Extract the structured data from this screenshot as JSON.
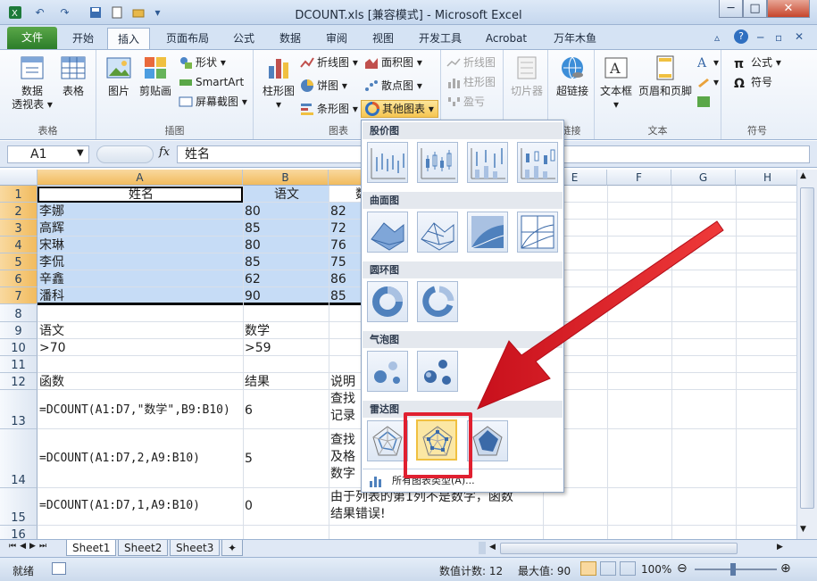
{
  "window": {
    "title": "DCOUNT.xls  [兼容模式] - Microsoft Excel",
    "minimize": "─",
    "restore": "□",
    "close": "✕"
  },
  "ribbon_tabs": [
    "文件",
    "开始",
    "插入",
    "页面布局",
    "公式",
    "数据",
    "审阅",
    "视图",
    "开发工具",
    "Acrobat",
    "万年木鱼"
  ],
  "ribbon": {
    "groups": {
      "tables": "表格",
      "illustrations": "插图",
      "charts": "图表",
      "links": "链接",
      "text": "文本",
      "symbols": "符号"
    },
    "pivot": "数据\n透视表",
    "pivot_line1": "数据",
    "pivot_line2": "透视表",
    "table": "表格",
    "picture": "图片",
    "clipart": "剪贴画",
    "shapes": "形状",
    "smartart": "SmartArt",
    "screenshot": "屏幕截图",
    "column_chart": "柱形图",
    "line_chart": "折线图",
    "pie_chart": "饼图",
    "bar_chart": "条形图",
    "area_chart": "面积图",
    "scatter_chart": "散点图",
    "other_charts": "其他图表",
    "spark_line": "折线图",
    "spark_column": "柱形图",
    "spark_winloss": "盈亏",
    "slicer": "切片器",
    "hyperlink": "超链接",
    "textbox": "文本框",
    "header_footer": "页眉和页脚",
    "formula": "公式",
    "symbol": "符号"
  },
  "formula_bar": {
    "name_box": "A1",
    "fx": "fx",
    "content": "姓名"
  },
  "columns": [
    "A",
    "B",
    "C",
    "D",
    "E",
    "F",
    "G",
    "H"
  ],
  "rows": [
    "1",
    "2",
    "3",
    "4",
    "5",
    "6",
    "7",
    "8",
    "9",
    "10",
    "11",
    "12",
    "13",
    "14",
    "15",
    "16"
  ],
  "cells": {
    "r1": [
      "姓名",
      "语文",
      "数"
    ],
    "r2": [
      "李娜",
      "80",
      "82"
    ],
    "r3": [
      "高辉",
      "85",
      "72"
    ],
    "r4": [
      "宋琳",
      "80",
      "76"
    ],
    "r5": [
      "李侃",
      "85",
      "75"
    ],
    "r6": [
      "辛鑫",
      "62",
      "86"
    ],
    "r7": [
      "潘科",
      "90",
      "85"
    ],
    "r9": [
      "语文",
      "数学"
    ],
    "r10": [
      ">70",
      ">59"
    ],
    "r12": [
      "函数",
      "结果",
      "说明"
    ],
    "r13": [
      "=DCOUNT(A1:D7,\"数学\",B9:B10)",
      "6",
      "查找",
      "记录"
    ],
    "r14": [
      "=DCOUNT(A1:D7,2,A9:B10)",
      "5",
      "查找",
      "及格",
      "数字"
    ],
    "r15": [
      "=DCOUNT(A1:D7,1,A9:B10)",
      "0",
      "由于列表的第1列不是数字，函数",
      "结果错误!"
    ]
  },
  "gallery": {
    "sections": [
      "股价图",
      "曲面图",
      "圆环图",
      "气泡图",
      "雷达图"
    ],
    "all_types": "所有图表类型(A)..."
  },
  "sheets": [
    "Sheet1",
    "Sheet2",
    "Sheet3"
  ],
  "status": {
    "ready": "就绪",
    "count": "数值计数: 12",
    "max": "最大值: 90",
    "zoom": "100%"
  },
  "colors": {
    "selection": "#c6dcf6",
    "highlight": "#e02030",
    "file_tab": "#2c7d2a"
  }
}
